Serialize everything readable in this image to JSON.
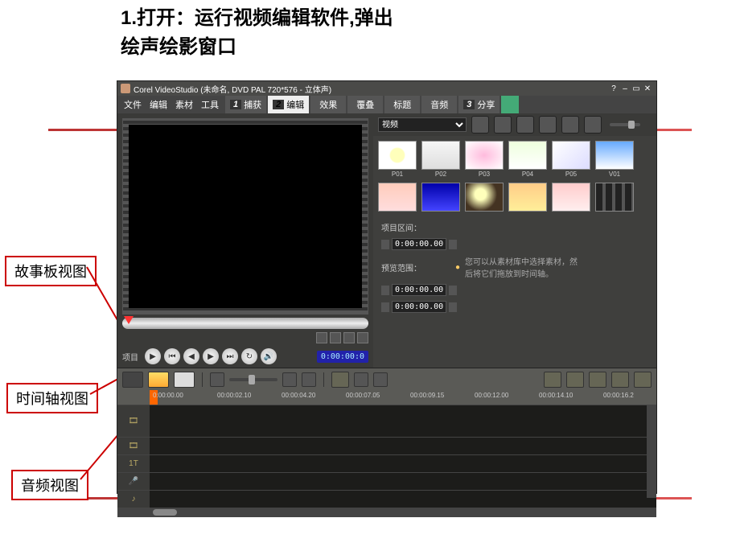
{
  "slide": {
    "title_line1": "1.打开：运行视频编辑软件,弹出",
    "title_line2": "绘声绘影窗口"
  },
  "annotations": {
    "storyboard": "故事板视图",
    "timeline": "时间轴视图",
    "audio": "音频视图"
  },
  "app": {
    "title": "Corel VideoStudio (未命名, DVD PAL 720*576 - 立体声)",
    "win_help": "?",
    "win_min": "–",
    "win_max": "▭",
    "win_close": "✕",
    "menus": {
      "file": "文件",
      "edit": "编辑",
      "clip": "素材",
      "tool": "工具"
    },
    "steps": {
      "capture_num": "1",
      "capture": "捕获",
      "edit_num": "2",
      "edit": "编辑",
      "share_num": "3",
      "share": "分享"
    },
    "tooltabs": {
      "effect": "效果",
      "overlay": "覆叠",
      "title": "标题",
      "audio": "音频"
    },
    "preview": {
      "mode_label": "项目",
      "timecode": "0:00:00:0",
      "play": "▶",
      "start": "⏮",
      "prevf": "◀",
      "nextf": "▶",
      "end": "⏭",
      "repeat": "↻",
      "vol": "🔊"
    },
    "library": {
      "dropdown": "视频",
      "thumbs_row1": [
        "P01",
        "P02",
        "P03",
        "P04",
        "P05",
        "V01"
      ],
      "thumbs_row2": [
        "",
        "",
        "",
        "",
        "",
        ""
      ]
    },
    "props": {
      "duration_label": "项目区间：",
      "duration_value": "0:00:00.00",
      "preview_label": "预览范围：",
      "in_value": "0:00:00.00",
      "out_value": "0:00:00.00",
      "hint": "您可以从素材库中选择素材，然后将它们拖放到时间轴。"
    },
    "ruler": [
      "0:00:00.00",
      "00:00:02.10",
      "00:00:04.20",
      "00:00:07.05",
      "00:00:09.15",
      "00:00:12.00",
      "00:00:14.10",
      "00:00:16.2"
    ],
    "tracks": {
      "video": "🎞",
      "overlay": "🎞",
      "title": "1T",
      "voice": "🎤",
      "music": "♪"
    }
  }
}
